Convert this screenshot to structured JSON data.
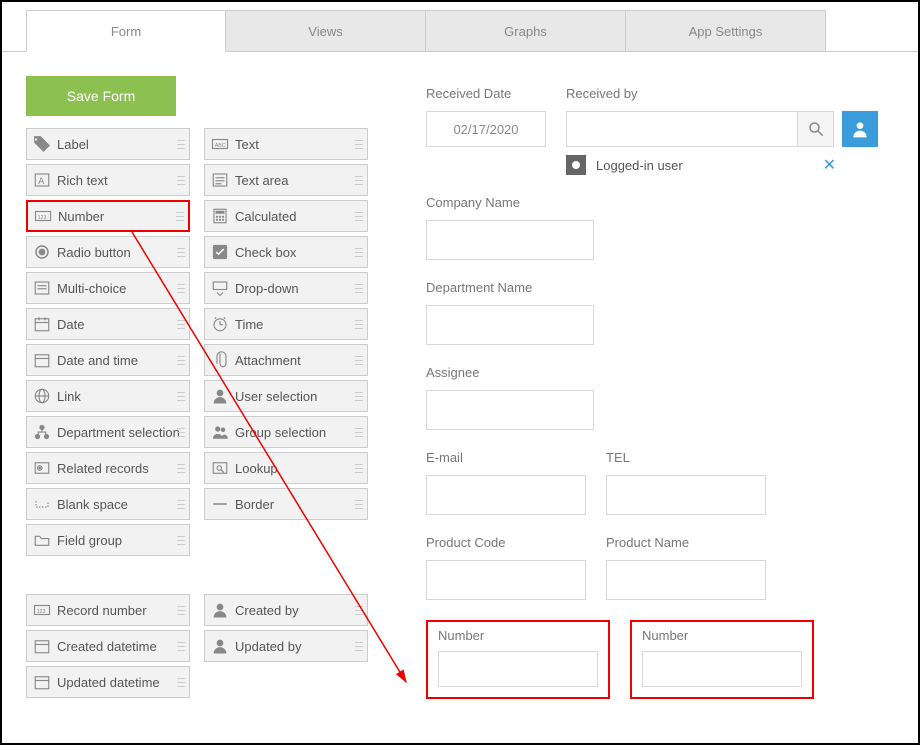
{
  "tabs": [
    "Form",
    "Views",
    "Graphs",
    "App Settings"
  ],
  "saveLabel": "Save Form",
  "palette": {
    "col1": [
      "Label",
      "Rich text",
      "Number",
      "Radio button",
      "Multi-choice",
      "Date",
      "Date and time",
      "Link",
      "Department selection",
      "Related records",
      "Blank space",
      "Field group"
    ],
    "col2": [
      "Text",
      "Text area",
      "Calculated",
      "Check box",
      "Drop-down",
      "Time",
      "Attachment",
      "User selection",
      "Group selection",
      "Lookup",
      "Border"
    ]
  },
  "palette2": {
    "col1": [
      "Record number",
      "Created datetime",
      "Updated datetime"
    ],
    "col2": [
      "Created by",
      "Updated by"
    ]
  },
  "form": {
    "receivedDateLabel": "Received Date",
    "receivedDateValue": "02/17/2020",
    "receivedByLabel": "Received by",
    "loggedInUser": "Logged-in user",
    "companyName": "Company Name",
    "departmentName": "Department Name",
    "assignee": "Assignee",
    "email": "E-mail",
    "tel": "TEL",
    "productCode": "Product Code",
    "productName": "Product Name",
    "numberLabel": "Number"
  }
}
